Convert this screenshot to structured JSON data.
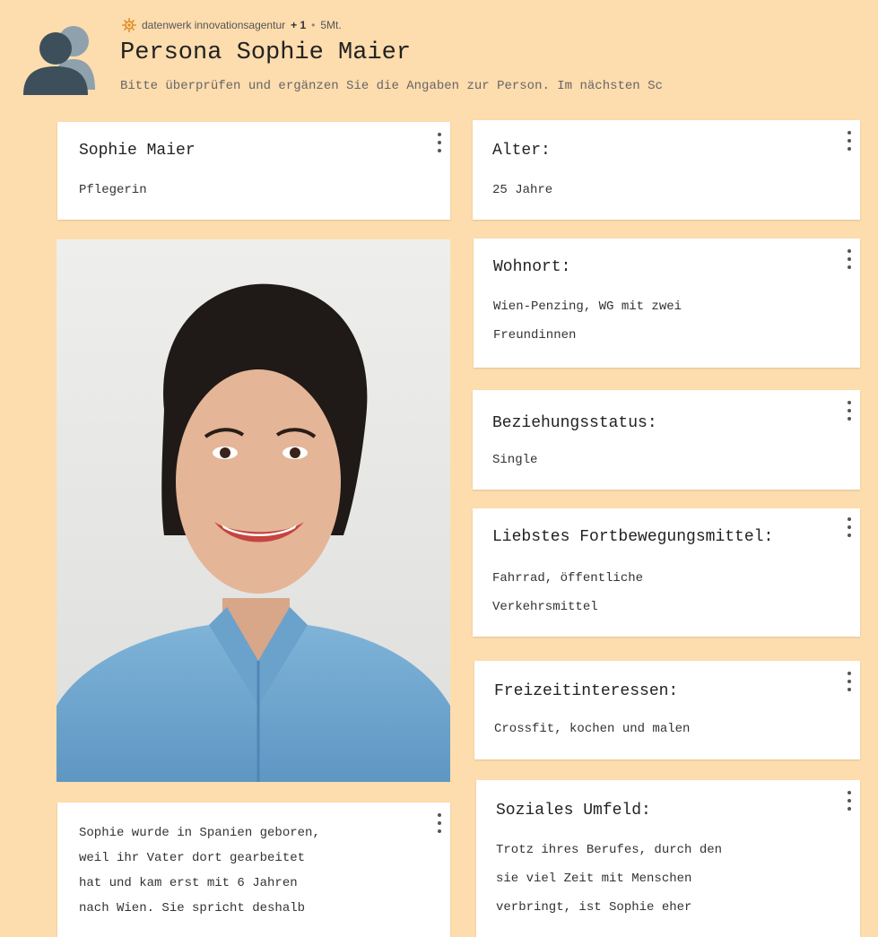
{
  "header": {
    "org": "datenwerk innovationsagentur",
    "extra_count": "+ 1",
    "separator": "•",
    "time": "5Mt.",
    "title": "Persona Sophie Maier",
    "subtitle": "Bitte überprüfen und ergänzen Sie die Angaben zur Person. Im nächsten Sc"
  },
  "cards": {
    "name": {
      "title": "Sophie Maier",
      "text": "Pflegerin"
    },
    "age": {
      "title": "Alter:",
      "text": "25 Jahre"
    },
    "residence": {
      "title": "Wohnort:",
      "line1": "Wien-Penzing, WG mit zwei",
      "line2": "Freundinnen"
    },
    "relationship": {
      "title": "Beziehungsstatus:",
      "text": "Single"
    },
    "transport": {
      "title": "Liebstes Fortbewegungsmittel:",
      "line1": "Fahrrad, öffentliche",
      "line2": "Verkehrsmittel"
    },
    "hobbies": {
      "title": "Freizeitinteressen:",
      "text": "Crossfit, kochen und malen"
    },
    "social": {
      "title": "Soziales Umfeld:",
      "line1": "Trotz ihres Berufes, durch den",
      "line2": "sie viel Zeit mit Menschen",
      "line3": "verbringt, ist Sophie eher"
    },
    "bio": {
      "line1": "Sophie wurde in Spanien geboren,",
      "line2": "weil ihr Vater dort gearbeitet",
      "line3": "hat und kam erst mit 6 Jahren",
      "line4": "nach Wien. Sie spricht deshalb"
    }
  },
  "colors": {
    "background": "#fddcae",
    "card": "#ffffff",
    "accent_orange": "#e08a1e",
    "avatar_dark": "#3d4f5a",
    "avatar_light": "#8ea1ad"
  },
  "icons": {
    "avatar": "persona-avatar-icon",
    "org": "sun-icon",
    "menu": "kebab-menu-icon"
  }
}
